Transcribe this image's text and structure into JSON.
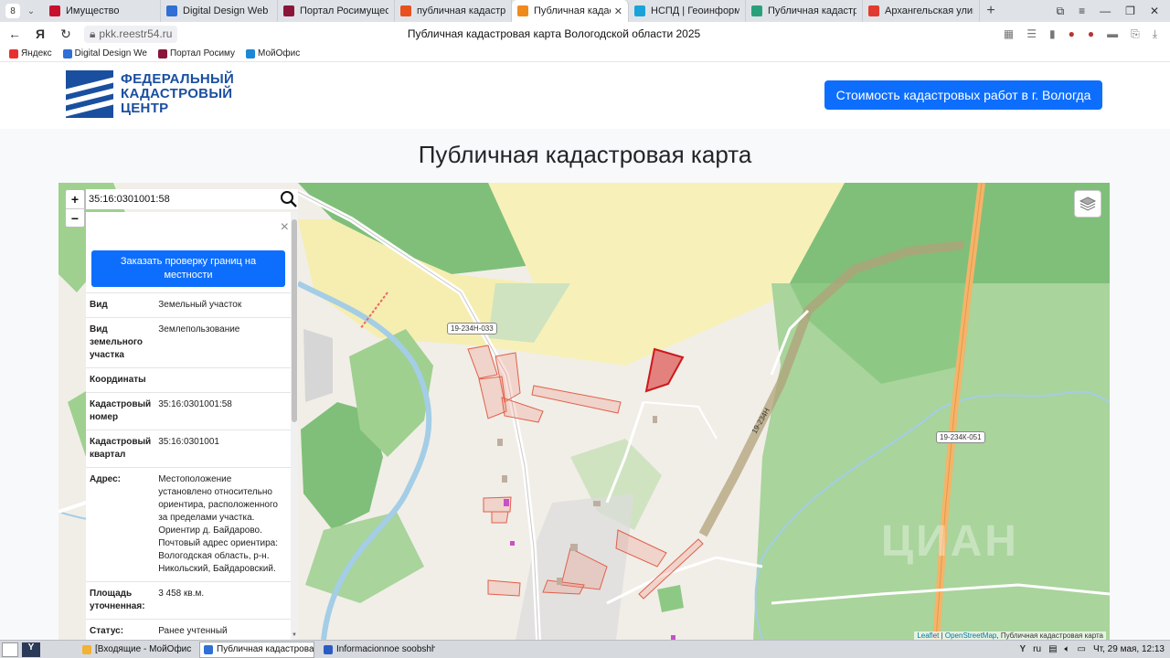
{
  "browser": {
    "tab_count": "8",
    "tabs": [
      {
        "label": "Имущество",
        "favicon_color": "#c8102e"
      },
      {
        "label": "Digital Design Web Client",
        "favicon_color": "#2f6fd6"
      },
      {
        "label": "Портал Росимущества",
        "favicon_color": "#8a1538"
      },
      {
        "label": "публичная кадастровая",
        "favicon_color": "#e8501e"
      },
      {
        "label": "Публичная кадастров",
        "favicon_color": "#f08a1c",
        "active": true
      },
      {
        "label": "НСПД | Геоинформаци",
        "favicon_color": "#1aa3d9"
      },
      {
        "label": "Публичная кадастрова",
        "favicon_color": "#2aa07a"
      },
      {
        "label": "Архангельская улица, В",
        "favicon_color": "#e23a2e"
      }
    ],
    "url": "pkk.reestr54.ru",
    "page_title": "Публичная кадастровая карта Вологодской области 2025",
    "bookmarks": [
      {
        "label": "Яндекс",
        "color": "#e8312f"
      },
      {
        "label": "Digital Design We",
        "color": "#2f6fd6"
      },
      {
        "label": "Портал Росиму",
        "color": "#8a1538"
      },
      {
        "label": "МойОфис",
        "color": "#1a88d6"
      }
    ]
  },
  "site": {
    "logo_lines": [
      "ФЕДЕРАЛЬНЫЙ",
      "КАДАСТРОВЫЙ",
      "ЦЕНТР"
    ],
    "cta_button": "Стоимость кадастровых работ в г. Вологда",
    "heading": "Публичная кадастровая карта"
  },
  "map": {
    "search_value": "35:16:0301001:58",
    "zoom_in": "+",
    "zoom_out": "−",
    "road_labels": [
      "19-234Н-033",
      "19-234К-051",
      "19-234Н"
    ],
    "attribution_leaflet": "Leaflet",
    "attribution_osm": "OpenStreetMap",
    "attribution_rest": "Публичная кадастровая карта",
    "watermark": "ЦИАН"
  },
  "panel": {
    "close": "×",
    "order_button": "Заказать проверку границ на местности",
    "properties": [
      {
        "key": "Вид",
        "value": "Земельный участок"
      },
      {
        "key": "Вид земельного участка",
        "value": "Землепользование"
      },
      {
        "key": "Координаты",
        "value": ""
      },
      {
        "key": "Кадастровый номер",
        "value": "35:16:0301001:58"
      },
      {
        "key": "Кадастровый квартал",
        "value": "35:16:0301001"
      },
      {
        "key": "Адрес:",
        "value": "Местоположение установлено относительно ориентира, расположенного за пределами участка. Ориентир д. Байдарово. Почтовый адрес ориентира: Вологодская область, р-н. Никольский, Байдаровский."
      },
      {
        "key": "Площадь уточненная:",
        "value": "3 458 кв.м."
      },
      {
        "key": "Статус:",
        "value": "Ранее учтенный"
      }
    ]
  },
  "taskbar": {
    "items": [
      {
        "label": "[Входящие - МойОфис П...",
        "color": "#f2b233"
      },
      {
        "label": "Публичная кадастровая ...",
        "color": "#2f6fd6",
        "active": true
      },
      {
        "label": "Informacionnoe soobshhe...",
        "color": "#2a5cc4"
      }
    ],
    "lang": "ru",
    "clock": "Чт, 29 мая, 12:13"
  }
}
